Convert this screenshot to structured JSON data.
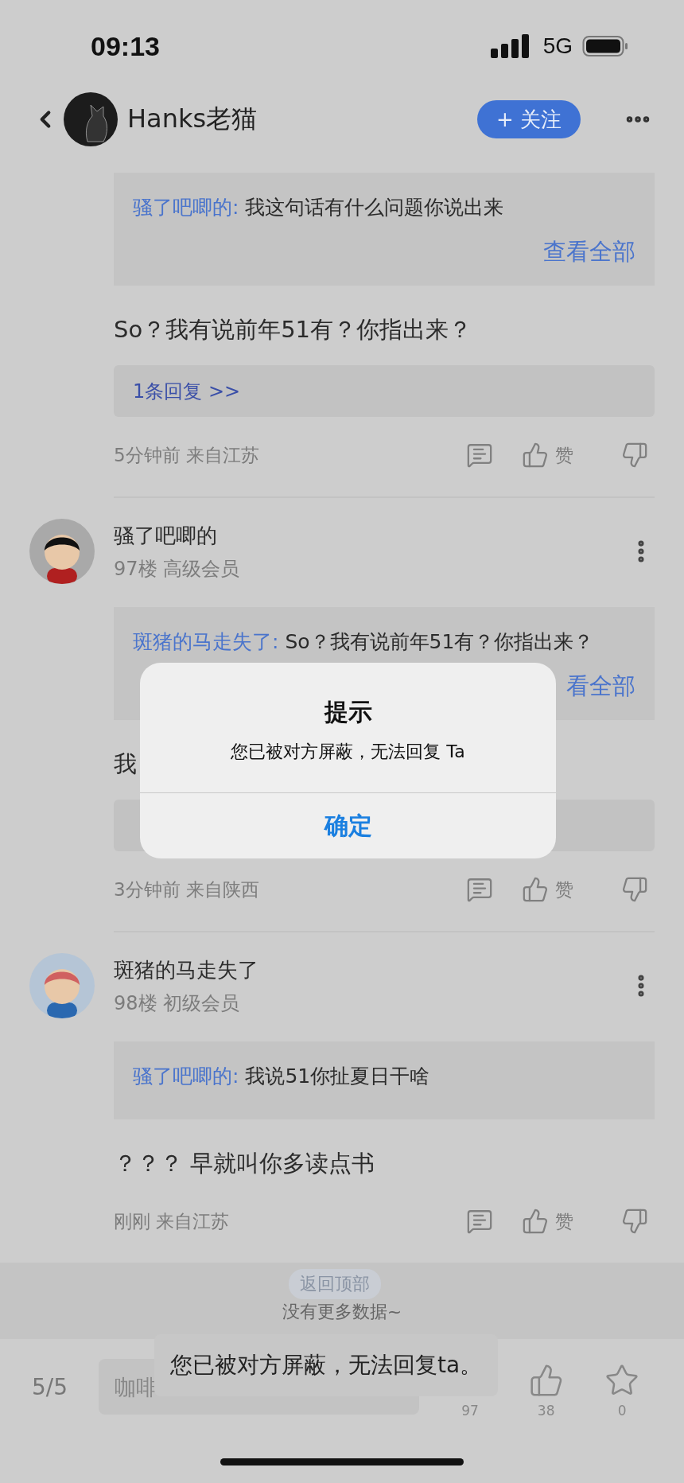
{
  "status_bar": {
    "time": "09:13",
    "network": "5G"
  },
  "header": {
    "title": "Hanks老猫",
    "follow_button": "+ 关注"
  },
  "comments": [
    {
      "kind": "continued",
      "quote": {
        "author": "骚了吧唧的:",
        "text": "我这句话有什么问题你说出来",
        "view_all": "查看全部"
      },
      "text": "So？我有说前年51有？你指出来？",
      "has_replies": true,
      "replies": "1条回复 >>",
      "meta": "5分钟前 来自江苏",
      "like_label": "赞"
    },
    {
      "kind": "full",
      "name": "骚了吧唧的",
      "info": "97楼 高级会员",
      "quote": {
        "author": "斑猪的马走失了:",
        "text": "So？我有说前年51有？你指出来？",
        "view_all": "看全部"
      },
      "text": "我",
      "has_replies": true,
      "meta": "3分钟前 来自陕西",
      "like_label": "赞"
    },
    {
      "kind": "full",
      "name": "斑猪的马走失了",
      "info": "98楼 初级会员",
      "quote": {
        "author": "骚了吧唧的:",
        "text": "我说51你扯夏日干啥"
      },
      "text": "？？？ 早就叫你多读点书",
      "meta": "刚刚 来自江苏",
      "like_label": "赞"
    }
  ],
  "footer": {
    "no_more": "没有更多数据~",
    "back_to_top": "返回顶部"
  },
  "bottom_bar": {
    "page": "5/5",
    "input": {
      "placeholder": "咖啡"
    },
    "actions": [
      {
        "kind": "comment",
        "count": "97"
      },
      {
        "kind": "like",
        "count": "38"
      },
      {
        "kind": "star",
        "count": "0"
      }
    ]
  },
  "toast": "您已被对方屏蔽，无法回复ta。",
  "dialog": {
    "title": "提示",
    "message": "您已被对方屏蔽，无法回复 Ta",
    "button": "确定"
  }
}
